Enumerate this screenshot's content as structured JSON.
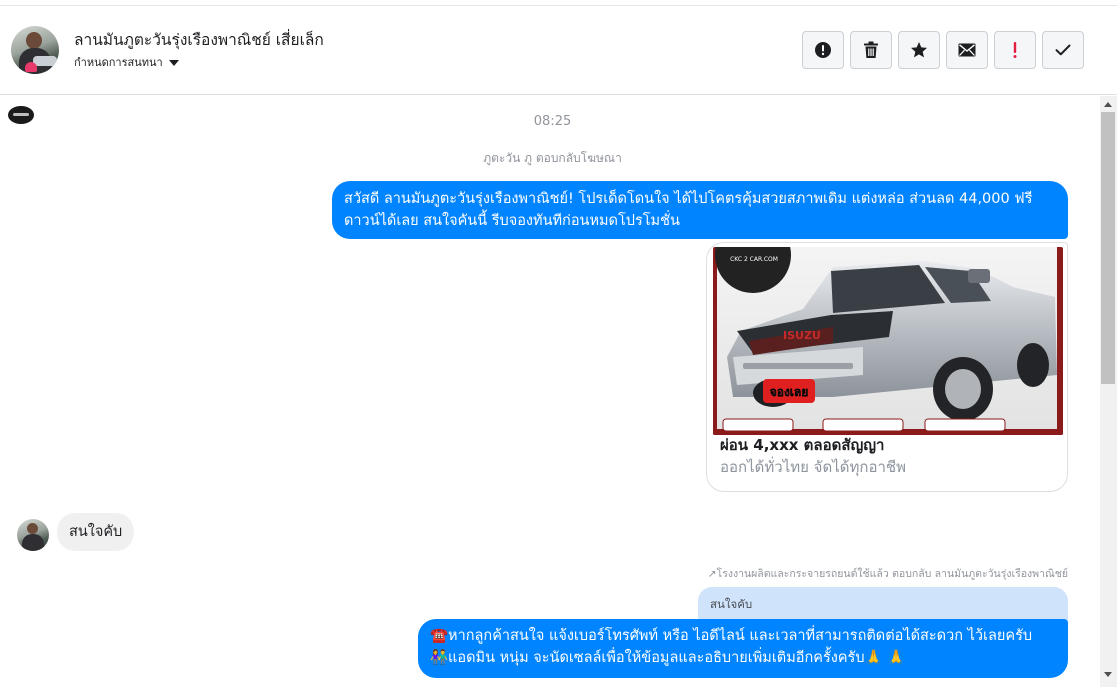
{
  "header": {
    "conversation_name": "ลานมันภูตะวันรุ่งเรืองพาณิชย์ เสี่ยเล็ก",
    "assign_label": "กำหนดการสนทนา",
    "actions": [
      {
        "name": "mark-spam",
        "icon": "alert-circle-icon"
      },
      {
        "name": "delete",
        "icon": "trash-icon"
      },
      {
        "name": "star",
        "icon": "star-icon"
      },
      {
        "name": "mark-unread",
        "icon": "envelope-icon"
      },
      {
        "name": "follow-up",
        "icon": "exclamation-icon"
      },
      {
        "name": "mark-done",
        "icon": "checkmark-icon"
      }
    ]
  },
  "chat": {
    "timestamp": "08:25",
    "sender_note": "ภูตะวัน ภู ตอบกลับโฆษณา",
    "messages": {
      "outgoing_1": "สวัสดี ลานมันภูตะวันรุ่งเรืองพาณิชย์! โปรเด็ดโดนใจ ได้ไปโคตรคุ้มสวยสภาพเดิม แต่งหล่อ  ส่วนลด 44,000 ฟรีดาวน์ได้เลย  สนใจคันนี้ รีบจองทันทีก่อนหมดโปรโมชั่น",
      "ad_card": {
        "watermark": "CKC 2 CAR.COM",
        "badge": "จองเลย",
        "brand": "ISUZU",
        "title": "ผ่อน 4,xxx ตลอดสัญญา",
        "subtitle": "ออกได้ทั่วไทย จัดได้ทุกอาชีพ"
      },
      "incoming_1": "สนใจคับ",
      "reply_note": "↗โรงงานผลิตและกระจายรถยนต์ใช้แล้ว ตอบกลับ ลานมันภูตะวันรุ่งเรืองพาณิชย์",
      "quoted": "สนใจคับ",
      "outgoing_2_line1": "☎️หากลูกค้าสนใจ แจ้งเบอร์โทรศัพท์ หรือ ไอดีไลน์ และเวลาที่สามารถติดต่อได้สะดวก ไว้เลยครับ",
      "outgoing_2_line2": "👫แอดมิน หนุ่ม จะนัดเซลล์เพื่อให้ข้อมูลและอธิบายเพิ่มเติมอีกครั้งครับ🙏 🙏"
    }
  },
  "colors": {
    "outgoing_bubble": "#0084ff",
    "incoming_bubble": "#f1f0f0",
    "quote_bubble": "#cfe3fb",
    "follow_up_red": "#e41e3f"
  }
}
